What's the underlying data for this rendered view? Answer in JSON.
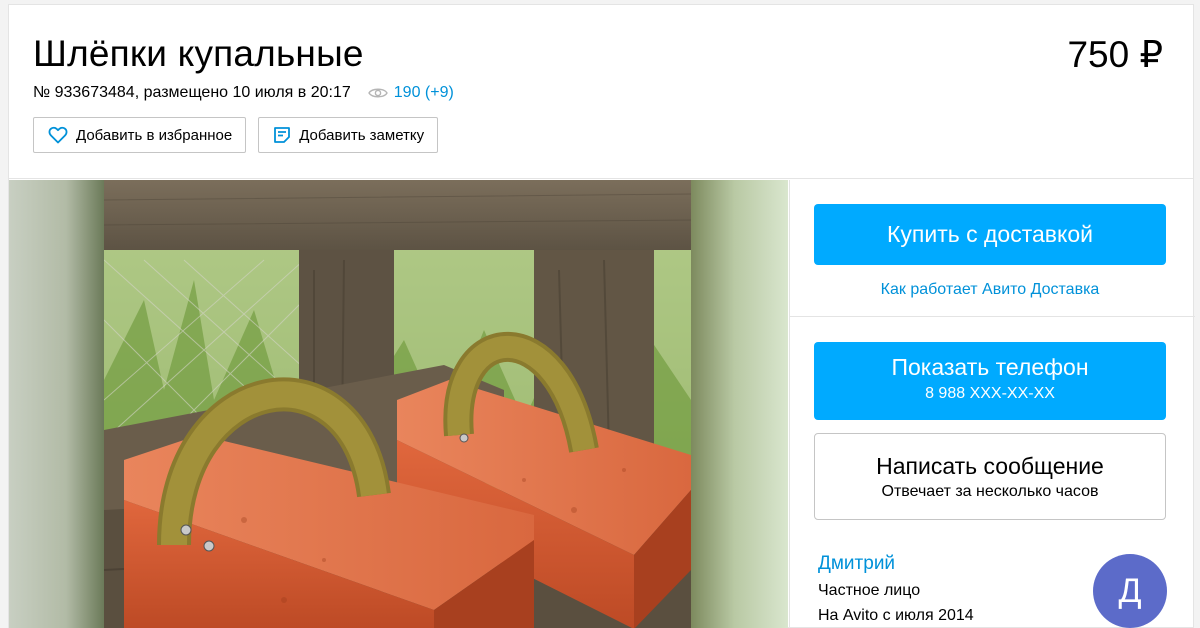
{
  "listing": {
    "title": "Шлёпки купальные",
    "price": "750 ₽",
    "meta": "№ 933673484, размещено 10 июля в 20:17",
    "views": "190 (+9)"
  },
  "actions": {
    "favorite_label": "Добавить в избранное",
    "note_label": "Добавить заметку"
  },
  "sidebar": {
    "buy_label": "Купить с доставкой",
    "delivery_link": "Как работает Авито Доставка",
    "phone_label": "Показать телефон",
    "phone_number": "8 988 XXX-XX-XX",
    "message_label": "Написать сообщение",
    "message_sub": "Отвечает за несколько часов"
  },
  "seller": {
    "name": "Дмитрий",
    "type": "Частное лицо",
    "since": "На Avito с июля 2014",
    "avatar_letter": "Д"
  },
  "colors": {
    "accent": "#00aaff",
    "link": "#0091d9",
    "avatar": "#5c6bc9"
  },
  "icons": [
    "eye-icon",
    "heart-icon",
    "note-icon"
  ]
}
